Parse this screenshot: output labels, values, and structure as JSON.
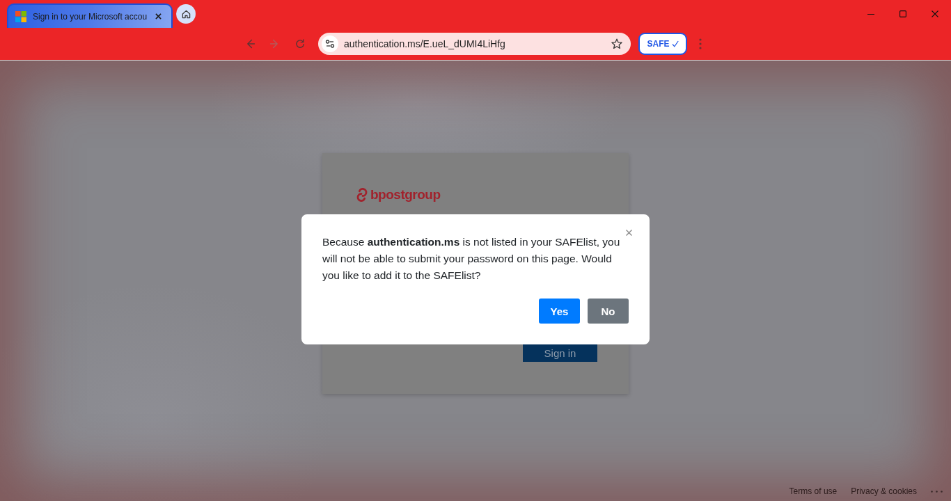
{
  "browser": {
    "tab": {
      "title": "Sign in to your Microsoft accou",
      "selected": true
    },
    "navigation": [
      {
        "kind": "back",
        "disabled": false
      },
      {
        "kind": "forward",
        "disabled": true
      },
      {
        "kind": "reload",
        "disabled": false
      }
    ],
    "address": "authentication.ms/E.ueL_dUMI4LiHfg",
    "safe_button": "SAFE"
  },
  "login_card": {
    "logo": "bpostgroup",
    "sign_in_button": "Sign in"
  },
  "dialog": {
    "message": "Because **authentication.ms** is not listed in your SAFElist, you will not be able to submit your password on this page. Would you like to add it to the SAFElist?",
    "buttons": [
      {
        "label": "Yes",
        "kind": "primary"
      },
      {
        "label": "No",
        "kind": "secondary"
      }
    ]
  },
  "footer": {
    "links": [
      "Terms of use",
      "Privacy & cookies"
    ]
  }
}
